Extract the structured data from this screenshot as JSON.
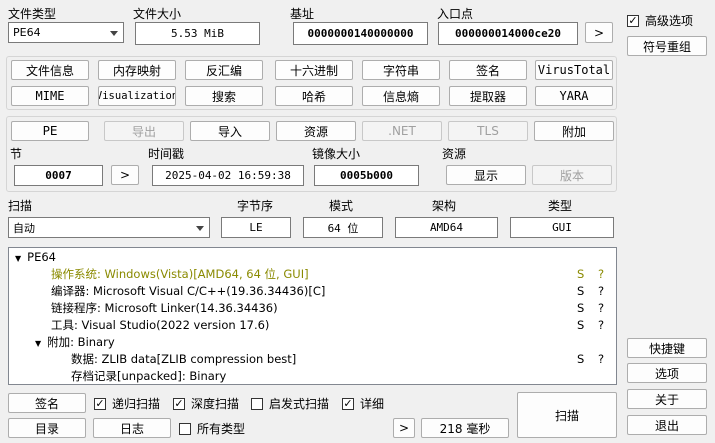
{
  "header": {
    "file_type_label": "文件类型",
    "file_type_value": "PE64",
    "file_size_label": "文件大小",
    "file_size_value": "5.53 MiB",
    "base_label": "基址",
    "base_value": "0000000140000000",
    "entry_label": "入口点",
    "entry_value": "000000014000ce20",
    "entry_go": ">",
    "advanced_label": "高级选项",
    "advanced_checked": true,
    "rebuild_symbols": "符号重组"
  },
  "toolbar1": [
    "文件信息",
    "内存映射",
    "反汇编",
    "十六进制",
    "字符串",
    "签名",
    "VirusTotal"
  ],
  "toolbar2": [
    "MIME",
    "Visualization",
    "搜索",
    "哈希",
    "信息熵",
    "提取器",
    "YARA"
  ],
  "pe_row": {
    "pe": "PE",
    "export": "导出",
    "import": "导入",
    "resources": "资源",
    "net": ".NET",
    "tls": "TLS",
    "overlay": "附加"
  },
  "info_row": {
    "section_label": "节",
    "section_value": "0007",
    "section_go": ">",
    "timestamp_label": "时间戳",
    "timestamp_value": "2025-04-02 16:59:38",
    "image_size_label": "镜像大小",
    "image_size_value": "0005b000",
    "resources_label": "资源",
    "show_button": "显示",
    "version_button": "版本"
  },
  "scan_row": {
    "scan_label": "扫描",
    "scan_value": "自动",
    "endian_label": "字节序",
    "endian_value": "LE",
    "mode_label": "模式",
    "mode_value": "64 位",
    "arch_label": "架构",
    "arch_value": "AMD64",
    "type_label": "类型",
    "type_value": "GUI"
  },
  "tree": {
    "root": "PE64",
    "items": [
      {
        "text": "操作系统: Windows(Vista)[AMD64, 64 位, GUI]",
        "s": "S",
        "q": "?"
      },
      {
        "text": "编译器: Microsoft Visual C/C++(19.36.34436)[C]",
        "s": "S",
        "q": "?"
      },
      {
        "text": "链接程序: Microsoft Linker(14.36.34436)",
        "s": "S",
        "q": "?"
      },
      {
        "text": "工具: Visual Studio(2022 version 17.6)",
        "s": "S",
        "q": "?"
      }
    ],
    "overlay_node": "附加: Binary",
    "overlay_items": [
      {
        "text": "数据: ZLIB data[ZLIB compression best]",
        "s": "S",
        "q": "?"
      },
      {
        "text": "存档记录[unpacked]: Binary",
        "s": "",
        "q": ""
      }
    ]
  },
  "bottom": {
    "signatures": "签名",
    "recursive": "递归扫描",
    "recursive_checked": true,
    "deep": "深度扫描",
    "deep_checked": true,
    "heuristic": "启发式扫描",
    "heuristic_checked": false,
    "verbose": "详细",
    "verbose_checked": true,
    "directory": "目录",
    "log": "日志",
    "all_types": "所有类型",
    "all_types_checked": false,
    "go": ">",
    "time": "218 毫秒",
    "scan": "扫描"
  },
  "side": {
    "shortcuts": "快捷键",
    "options": "选项",
    "about": "关于",
    "exit": "退出"
  }
}
